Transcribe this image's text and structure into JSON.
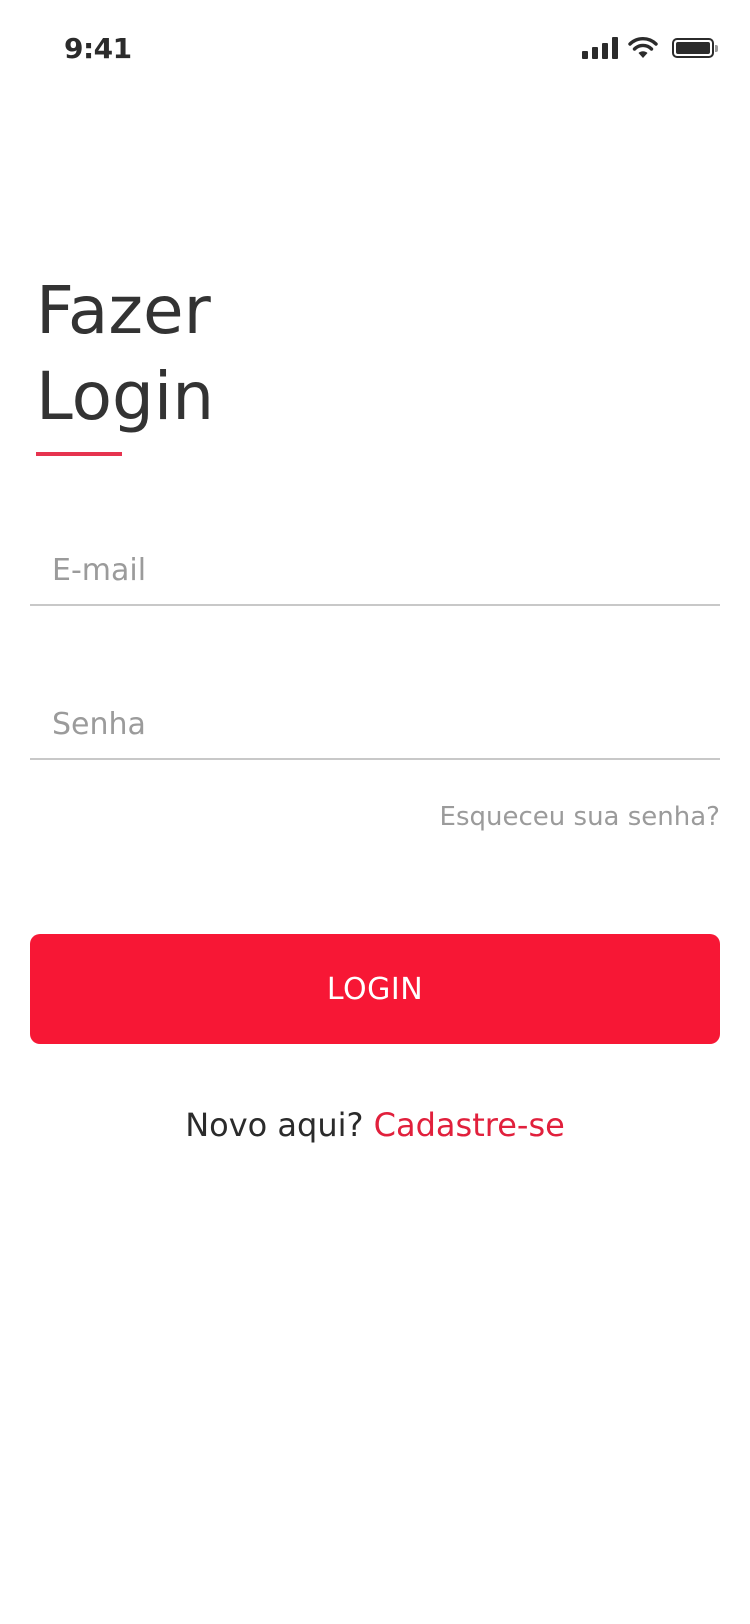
{
  "status_bar": {
    "time": "9:41",
    "icons": [
      "signal-icon",
      "wifi-icon",
      "battery-icon"
    ]
  },
  "login": {
    "title_line1": "Fazer",
    "title_line2": "Login",
    "email_placeholder": "E-mail",
    "email_value": "",
    "password_placeholder": "Senha",
    "password_value": "",
    "forgot_password": "Esqueceu sua senha?",
    "login_button": "LOGIN",
    "signup_prompt": "Novo aqui?",
    "signup_link": "Cadastre-se"
  },
  "colors": {
    "accent": "#f71735",
    "accent_text": "#e1203c",
    "underline": "#e6334f",
    "muted_text": "#9b9b9b",
    "input_border": "#c8c8c8",
    "primary_text": "#333333"
  }
}
